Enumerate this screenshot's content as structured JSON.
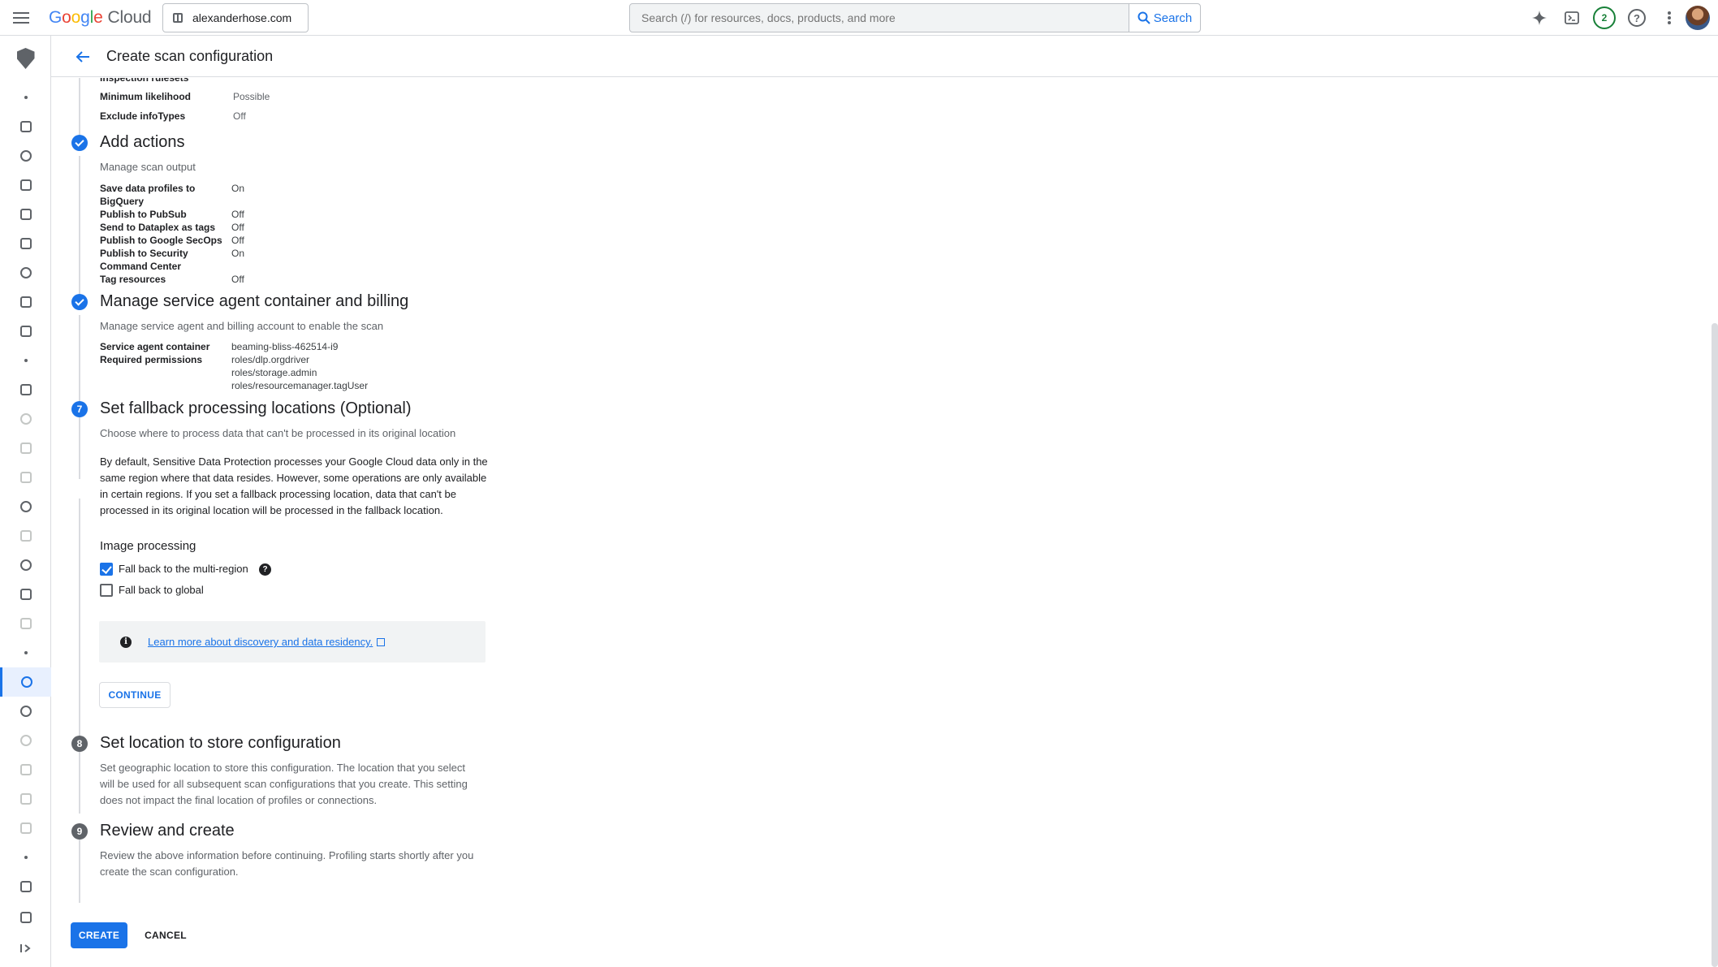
{
  "topbar": {
    "logo_google": "Google",
    "logo_cloud": "Cloud",
    "project": "alexanderhose.com",
    "search_placeholder": "Search (/) for resources, docs, products, and more",
    "search_button": "Search",
    "notification_count": "2",
    "help_glyph": "?"
  },
  "header": {
    "title": "Create scan configuration"
  },
  "inspection": {
    "cut_label": "Inspection rulesets",
    "rows": [
      {
        "label": "Minimum likelihood",
        "value": "Possible"
      },
      {
        "label": "Exclude infoTypes",
        "value": "Off"
      }
    ]
  },
  "actions": {
    "title": "Add actions",
    "subtitle": "Manage scan output",
    "rows": [
      {
        "label": "Save data profiles to BigQuery",
        "value": "On"
      },
      {
        "label": "Publish to PubSub",
        "value": "Off"
      },
      {
        "label": "Send to Dataplex as tags",
        "value": "Off"
      },
      {
        "label": "Publish to Google SecOps",
        "value": "Off"
      },
      {
        "label": "Publish to Security Command Center",
        "value": "On"
      },
      {
        "label": "Tag resources",
        "value": "Off"
      }
    ]
  },
  "service_agent": {
    "title": "Manage service agent container and billing",
    "subtitle": "Manage service agent and billing account to enable the scan",
    "container_label": "Service agent container",
    "container_value": "beaming-bliss-462514-i9",
    "permissions_label": "Required permissions",
    "permissions": [
      "roles/dlp.orgdriver",
      "roles/storage.admin",
      "roles/resourcemanager.tagUser"
    ]
  },
  "fallback": {
    "number": "7",
    "title": "Set fallback processing locations (Optional)",
    "subtitle": "Choose where to process data that can't be processed in its original location",
    "description": "By default, Sensitive Data Protection processes your Google Cloud data only in the same region where that data resides. However, some operations are only available in certain regions. If you set a fallback processing location, data that can't be processed in its original location will be processed in the fallback location.",
    "image_processing_heading": "Image processing",
    "option_multiregion": "Fall back to the multi-region",
    "option_multiregion_checked": true,
    "option_global": "Fall back to global",
    "option_global_checked": false,
    "info_link": "Learn more about discovery and data residency.",
    "continue_label": "CONTINUE"
  },
  "location": {
    "number": "8",
    "title": "Set location to store configuration",
    "description": "Set geographic location to store this configuration. The location that you select will be used for all subsequent scan configurations that you create. This setting does not impact the final location of profiles or connections."
  },
  "review": {
    "number": "9",
    "title": "Review and create",
    "description": "Review the above information before continuing. Profiling starts shortly after you create the scan configuration."
  },
  "footer": {
    "create_label": "CREATE",
    "cancel_label": "CANCEL"
  },
  "colors": {
    "accent": "#1a73e8",
    "pending_step": "#5f6368",
    "notification": "#188038"
  }
}
